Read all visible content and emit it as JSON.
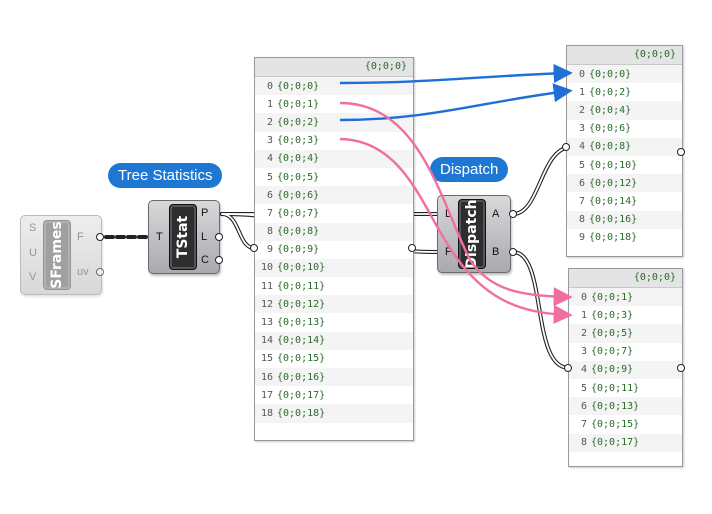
{
  "labels": {
    "tree_statistics": "Tree Statistics",
    "dispatch": "Dispatch"
  },
  "colors": {
    "blue_arrow": "#1f6fd6",
    "pink_arrow": "#f06ea0",
    "bubble": "#1f77d4"
  },
  "components": {
    "sframes": {
      "name": "SFrames",
      "inputs": [
        "S",
        "U",
        "V"
      ],
      "outputs": [
        "F",
        "uv"
      ]
    },
    "tstat": {
      "name": "TStat",
      "inputs": [
        "T"
      ],
      "outputs": [
        "P",
        "L",
        "C"
      ]
    },
    "dispatch": {
      "name": "Dispatch",
      "inputs": [
        "L",
        "P"
      ],
      "outputs": [
        "A",
        "B"
      ]
    }
  },
  "panels": {
    "main": {
      "header": "{0;0;0}",
      "rows": [
        {
          "i": "0",
          "v": "{0;0;0}"
        },
        {
          "i": "1",
          "v": "{0;0;1}"
        },
        {
          "i": "2",
          "v": "{0;0;2}"
        },
        {
          "i": "3",
          "v": "{0;0;3}"
        },
        {
          "i": "4",
          "v": "{0;0;4}"
        },
        {
          "i": "5",
          "v": "{0;0;5}"
        },
        {
          "i": "6",
          "v": "{0;0;6}"
        },
        {
          "i": "7",
          "v": "{0;0;7}"
        },
        {
          "i": "8",
          "v": "{0;0;8}"
        },
        {
          "i": "9",
          "v": "{0;0;9}"
        },
        {
          "i": "10",
          "v": "{0;0;10}"
        },
        {
          "i": "11",
          "v": "{0;0;11}"
        },
        {
          "i": "12",
          "v": "{0;0;12}"
        },
        {
          "i": "13",
          "v": "{0;0;13}"
        },
        {
          "i": "14",
          "v": "{0;0;14}"
        },
        {
          "i": "15",
          "v": "{0;0;15}"
        },
        {
          "i": "16",
          "v": "{0;0;16}"
        },
        {
          "i": "17",
          "v": "{0;0;17}"
        },
        {
          "i": "18",
          "v": "{0;0;18}"
        }
      ]
    },
    "a": {
      "header": "{0;0;0}",
      "rows": [
        {
          "i": "0",
          "v": "{0;0;0}"
        },
        {
          "i": "1",
          "v": "{0;0;2}"
        },
        {
          "i": "2",
          "v": "{0;0;4}"
        },
        {
          "i": "3",
          "v": "{0;0;6}"
        },
        {
          "i": "4",
          "v": "{0;0;8}"
        },
        {
          "i": "5",
          "v": "{0;0;10}"
        },
        {
          "i": "6",
          "v": "{0;0;12}"
        },
        {
          "i": "7",
          "v": "{0;0;14}"
        },
        {
          "i": "8",
          "v": "{0;0;16}"
        },
        {
          "i": "9",
          "v": "{0;0;18}"
        }
      ]
    },
    "b": {
      "header": "{0;0;0}",
      "rows": [
        {
          "i": "0",
          "v": "{0;0;1}"
        },
        {
          "i": "1",
          "v": "{0;0;3}"
        },
        {
          "i": "2",
          "v": "{0;0;5}"
        },
        {
          "i": "3",
          "v": "{0;0;7}"
        },
        {
          "i": "4",
          "v": "{0;0;9}"
        },
        {
          "i": "5",
          "v": "{0;0;11}"
        },
        {
          "i": "6",
          "v": "{0;0;13}"
        },
        {
          "i": "7",
          "v": "{0;0;15}"
        },
        {
          "i": "8",
          "v": "{0;0;17}"
        }
      ]
    }
  }
}
